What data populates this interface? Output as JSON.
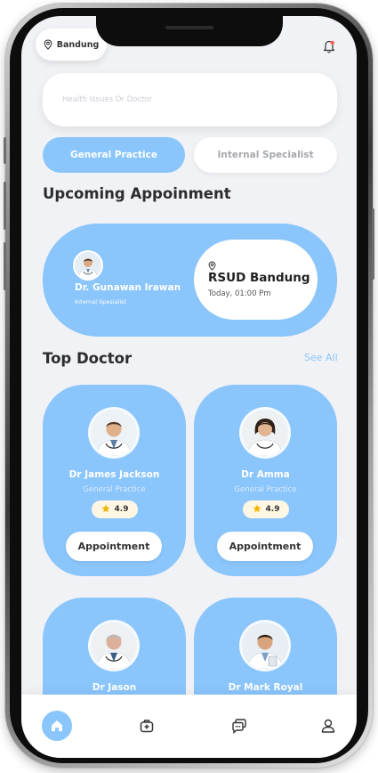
{
  "header": {
    "location": "Bandung"
  },
  "search": {
    "placeholder": "Health Issues Or Doctor"
  },
  "categories": [
    {
      "label": "General Practice",
      "active": true
    },
    {
      "label": "Internal Specialist",
      "active": false
    }
  ],
  "upcoming": {
    "title": "Upcoming Appoinment",
    "doctor_name": "Dr. Gunawan Irawan",
    "doctor_role": "Internal Spesialist",
    "hospital": "RSUD Bandung",
    "time": "Today, 01:00 Pm"
  },
  "top_doctor": {
    "title": "Top Doctor",
    "see_all": "See All",
    "doctors": [
      {
        "name": "Dr James Jackson",
        "specialty": "General Practice",
        "rating": "4.9",
        "button": "Appointment"
      },
      {
        "name": "Dr Amma",
        "specialty": "General Practice",
        "rating": "4.9",
        "button": "Appointment"
      },
      {
        "name": "Dr Jason"
      },
      {
        "name": "Dr Mark Royal"
      }
    ]
  },
  "nav": {
    "items": [
      "home-icon",
      "medical-kit-icon",
      "chat-icon",
      "profile-icon"
    ]
  },
  "colors": {
    "accent": "#8ac5fb",
    "background": "#f1f2f5",
    "star": "#f5b301"
  }
}
